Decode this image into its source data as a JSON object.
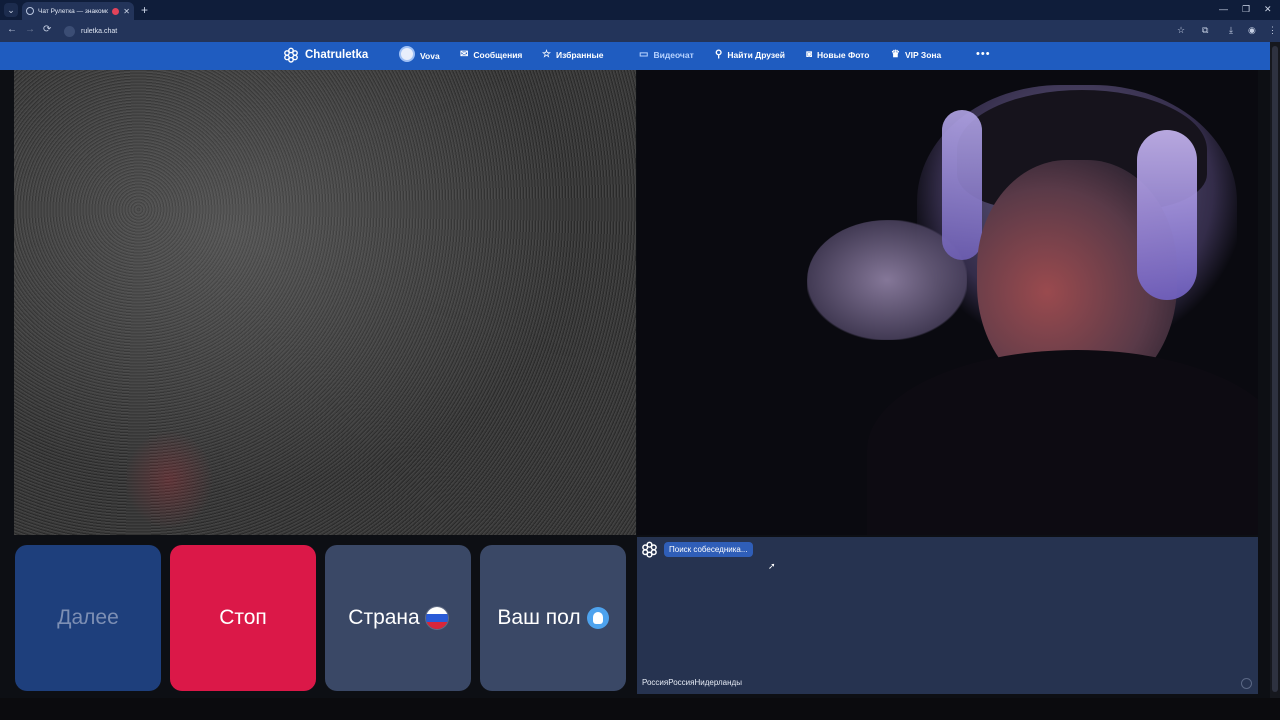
{
  "browser": {
    "tab_title": "Чат Рулетка — знакомств...",
    "tab_close": "✕",
    "new_tab": "+",
    "url": "ruletka.chat",
    "nav": {
      "back": "←",
      "forward": "→",
      "reload": "⟳"
    },
    "window_controls": {
      "minimize": "—",
      "restore": "❐",
      "close": "✕"
    },
    "toolbar_icons": [
      "star-icon",
      "extensions-icon",
      "download-icon",
      "profile-icon",
      "menu-icon"
    ]
  },
  "header": {
    "brand": "Chatruletka",
    "user_name": "Vova",
    "nav_items": [
      {
        "label": "Сообщения",
        "icon": "mail-icon",
        "glyph": "✉"
      },
      {
        "label": "Избранные",
        "icon": "star-icon",
        "glyph": "☆"
      },
      {
        "label": "Видеочат",
        "icon": "video-icon",
        "glyph": "▭",
        "active": true
      },
      {
        "label": "Найти Друзей",
        "icon": "search-icon",
        "glyph": "⚲"
      },
      {
        "label": "Новые Фото",
        "icon": "camera-icon",
        "glyph": "◙"
      },
      {
        "label": "VIP Зона",
        "icon": "crown-icon",
        "glyph": "♛"
      }
    ],
    "more": "•••"
  },
  "controls": {
    "next": "Далее",
    "stop": "Стоп",
    "country": "Страна",
    "gender": "Ваш пол"
  },
  "chat": {
    "status": "Поиск собеседника...",
    "input_text": "РоссияРоссияНидерланды"
  },
  "colors": {
    "header_bg": "#1f5cc0",
    "stop_bg": "#db1848",
    "next_bg": "#1e3f7c",
    "neutral_btn_bg": "#3a4866",
    "chat_bg": "#263350"
  }
}
